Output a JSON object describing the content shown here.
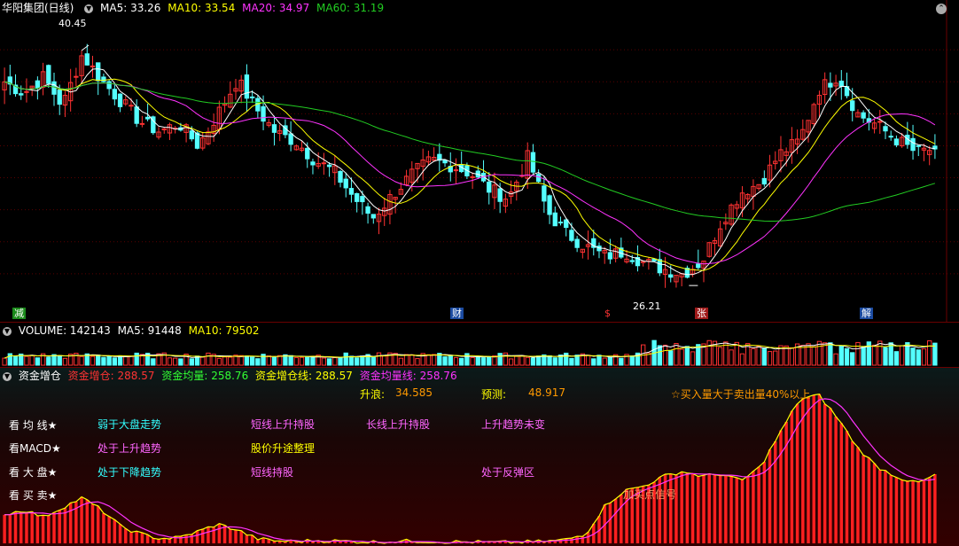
{
  "main": {
    "stock_name": "华阳集团(日线)",
    "ma5_label": "MA5: 33.26",
    "ma10_label": "MA10: 33.54",
    "ma20_label": "MA20: 34.97",
    "ma60_label": "MA60: 31.19",
    "high_label": "40.45",
    "low_label": "26.21",
    "markers": [
      "减",
      "财",
      "$",
      "张",
      "解"
    ]
  },
  "volume": {
    "title": "VOLUME: 142143",
    "ma5_label": "MA5: 91448",
    "ma10_label": "MA10: 79502"
  },
  "fund": {
    "title": "资金增仓",
    "v1": "资金增仓: 288.57",
    "v2": "资金均量: 258.76",
    "v3": "资金增仓线: 288.57",
    "v4": "资金均量线: 258.76",
    "rise_label": "升浪:",
    "rise_value": "34.585",
    "predict_label": "预测:",
    "predict_value": "48.917",
    "buy_note": "☆买入量大于卖出量40%以上",
    "row_labels": [
      "看 均 线★",
      "看MACD★",
      "看 大 盘★",
      "看 买 卖★"
    ],
    "texts": {
      "r1c1": "弱于大盘走势",
      "r1c2": "短线上升持股",
      "r1c3": "长线上升持股",
      "r1c4": "上升趋势未变",
      "r2c1": "处于上升趋势",
      "r2c2": "股价升途整理",
      "r3c1": "处于下降趋势",
      "r3c2": "短线持股",
      "r3c4": "处于反弹区",
      "r4": "加买点信号"
    }
  },
  "chart_data": [
    {
      "type": "candlestick",
      "title": "华阳集团(日线)",
      "ylim": [
        24.5,
        42.5
      ],
      "annotations": [
        {
          "label": "40.45",
          "value": 40.45
        },
        {
          "label": "26.21",
          "value": 26.21
        }
      ],
      "close_keypoints": [
        38.5,
        37.8,
        38.8,
        37.0,
        40.2,
        38.6,
        37.3,
        36.0,
        35.4,
        35.9,
        34.5,
        36.5,
        38.6,
        36.8,
        35.3,
        34.8,
        33.6,
        32.9,
        31.3,
        30.0,
        31.4,
        32.7,
        33.6,
        33.3,
        32.8,
        31.8,
        31.2,
        33.8,
        30.4,
        29.0,
        28.2,
        27.6,
        27.9,
        27.2,
        26.8,
        26.5,
        27.3,
        29.8,
        31.6,
        32.2,
        34.0,
        34.8,
        38.0,
        38.9,
        36.5,
        35.8,
        34.9,
        34.1,
        34.3
      ],
      "series": [
        {
          "name": "MA5",
          "color": "#ffff66",
          "value": 33.26
        },
        {
          "name": "MA10",
          "color": "#ffff66",
          "value": 33.54
        },
        {
          "name": "MA20",
          "color": "#ff33ff",
          "value": 34.97
        },
        {
          "name": "MA60",
          "color": "#33cc33",
          "value": 31.19
        }
      ]
    },
    {
      "type": "bar",
      "title": "VOLUME",
      "series": [
        {
          "name": "VOLUME",
          "value": 142143
        },
        {
          "name": "MA5",
          "value": 91448
        },
        {
          "name": "MA10",
          "value": 79502
        }
      ]
    },
    {
      "type": "area",
      "title": "资金增仓",
      "series": [
        {
          "name": "资金增仓",
          "color": "#ff3333",
          "value": 288.57
        },
        {
          "name": "资金均量",
          "color": "#ff33ff",
          "value": 258.76
        }
      ]
    }
  ],
  "colors": {
    "up": "#ff3232",
    "down": "#54ffff",
    "ma5": "#ffffff",
    "ma10": "#ffff00",
    "ma20": "#ff33ff",
    "ma60": "#22cc22",
    "grid": "#5a0000"
  }
}
